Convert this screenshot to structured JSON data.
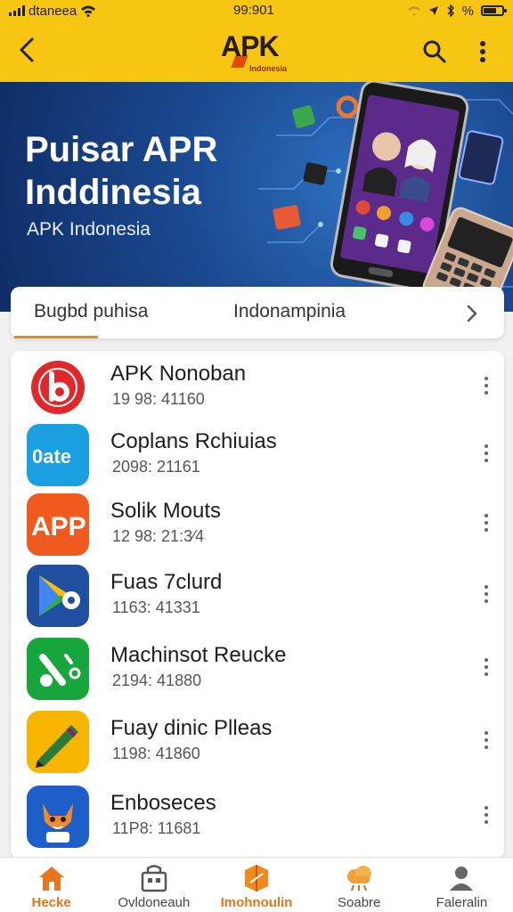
{
  "status_bar": {
    "carrier": "dtaneea",
    "time": "99:901",
    "battery_text": "%",
    "battery_level": 0.7
  },
  "app_bar": {
    "logo_text": "APK",
    "logo_subtext": "Indonesia"
  },
  "banner": {
    "title_line1": "Puisar APR",
    "title_line2": "Inddinesia",
    "subtitle": "APK Indonesia"
  },
  "tabs": {
    "items": [
      {
        "label": "Bugbd puhisa",
        "active": true
      },
      {
        "label": "Indonampinia",
        "active": false
      }
    ]
  },
  "apps": [
    {
      "name": "APK Nonoban",
      "meta": "19 98: 41160",
      "icon": "red-b-icon"
    },
    {
      "name": "Coplans Rchiuias",
      "meta": "2098: 21161",
      "icon": "blue-date-icon"
    },
    {
      "name": "Solik Mouts",
      "meta": "12 98: 21:3⁄4",
      "icon": "orange-app-icon"
    },
    {
      "name": "Fuas 7clurd",
      "meta": "1163: 41331",
      "icon": "play-store-icon"
    },
    {
      "name": "Machinsot Reucke",
      "meta": "2194: 41880",
      "icon": "green-tool-icon"
    },
    {
      "name": "Fuay dinic Plleas",
      "meta": "1198: 41860",
      "icon": "yellow-pen-icon"
    },
    {
      "name": "Enboseces",
      "meta": "11P8: 11681",
      "icon": "fox-icon"
    }
  ],
  "bottom_nav": {
    "items": [
      {
        "label": "Hecke",
        "icon": "home-icon",
        "active": true
      },
      {
        "label": "Ovldoneauh",
        "icon": "store-icon",
        "active": false
      },
      {
        "label": "Imohnoulin",
        "icon": "apk-icon",
        "active": true
      },
      {
        "label": "Soabre",
        "icon": "cloud-icon",
        "active": false
      },
      {
        "label": "Faleralin",
        "icon": "profile-icon",
        "active": false
      }
    ]
  },
  "colors": {
    "accent": "#f7c613",
    "active_tab": "#e08a2a",
    "banner_blue": "#1b4a91"
  }
}
